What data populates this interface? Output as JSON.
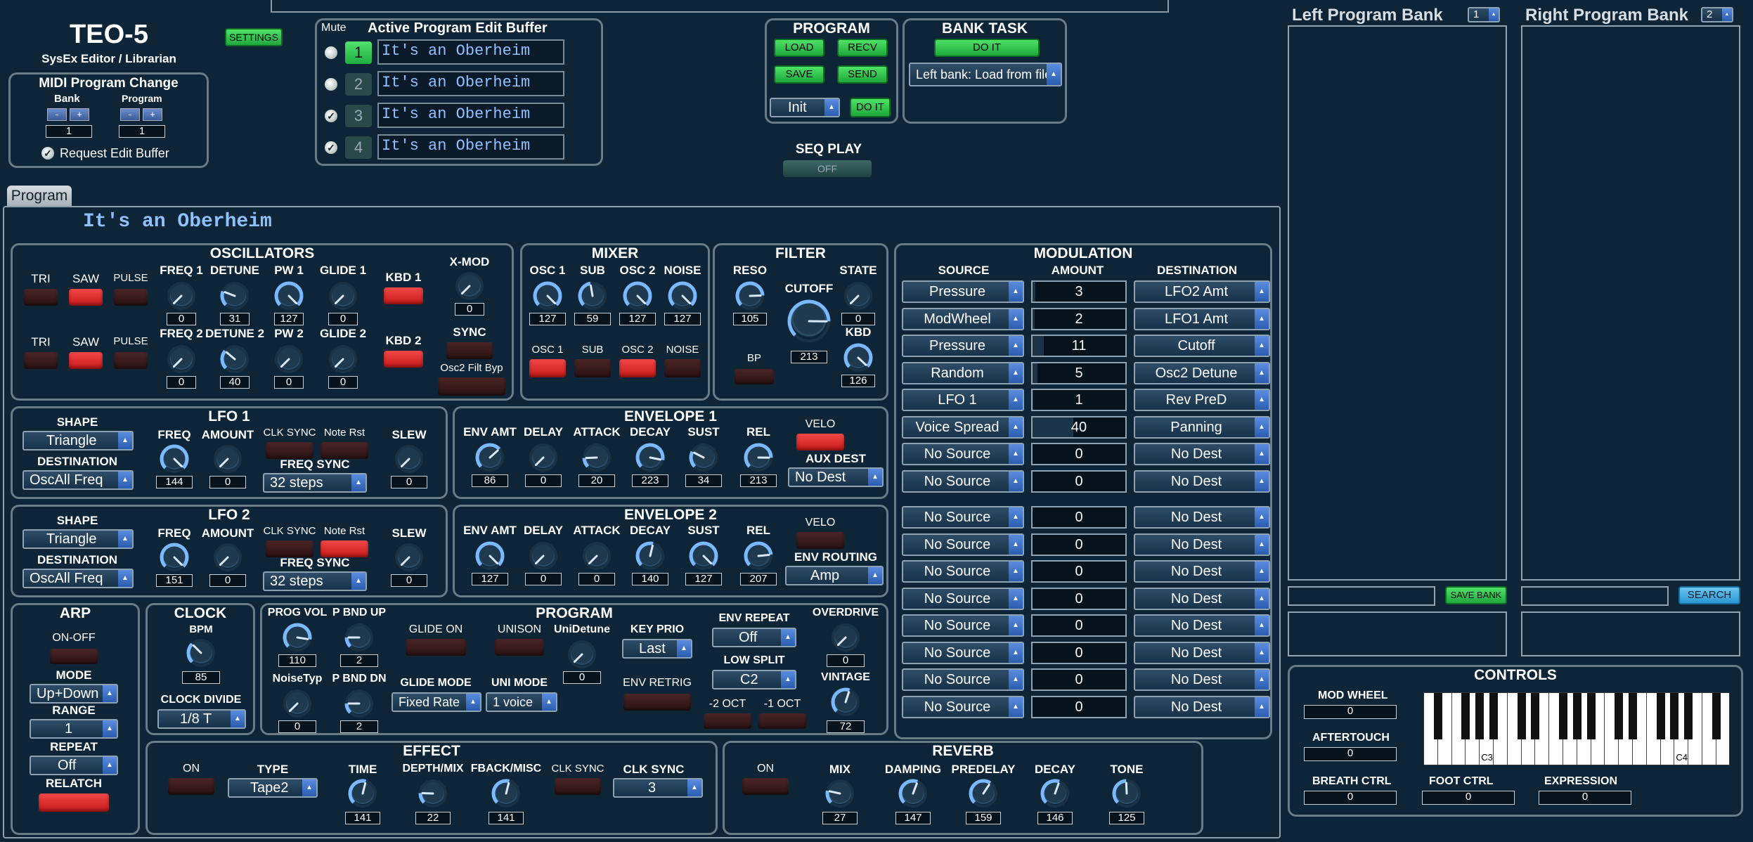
{
  "app": {
    "title": "TEO-5",
    "subtitle": "SysEx Editor / Librarian",
    "settings": "SETTINGS"
  },
  "midi": {
    "title": "MIDI Program Change",
    "bank_label": "Bank",
    "program_label": "Program",
    "bank_value": "1",
    "program_value": "1",
    "minus": "-",
    "plus": "+",
    "request_label": "Request Edit Buffer"
  },
  "edit_buffer": {
    "mute_label": "Mute",
    "title": "Active Program Edit Buffer",
    "slots": [
      {
        "num": "1",
        "name": "It's an Oberheim"
      },
      {
        "num": "2",
        "name": "It's an Oberheim"
      },
      {
        "num": "3",
        "name": "It's an Oberheim"
      },
      {
        "num": "4",
        "name": "It's an Oberheim"
      }
    ]
  },
  "program_box": {
    "title": "PROGRAM",
    "load": "LOAD",
    "recv": "RECV",
    "save": "SAVE",
    "send": "SEND",
    "init": "Init",
    "doit": "DO IT"
  },
  "bank_task": {
    "title": "BANK TASK",
    "doit": "DO IT",
    "select": "Left bank: Load from file"
  },
  "seq": {
    "title": "SEQ PLAY",
    "button": "OFF"
  },
  "tab": "Program",
  "program_name": "It's an Oberheim",
  "osc": {
    "title": "OSCILLATORS",
    "tri": "TRI",
    "saw": "SAW",
    "pulse": "PULSE",
    "freq1": "FREQ 1",
    "detune": "DETUNE",
    "pw1": "PW 1",
    "glide1": "GLIDE 1",
    "kbd1": "KBD 1",
    "xmod": "X-MOD",
    "freq2": "FREQ 2",
    "detune2": "DETUNE 2",
    "pw2": "PW 2",
    "glide2": "GLIDE 2",
    "kbd2": "KBD 2",
    "sync": "SYNC",
    "bypass": "Osc2 Filt Byp",
    "v_freq1": "0",
    "v_detune": "31",
    "v_pw1": "127",
    "v_glide1": "0",
    "v_xmod": "0",
    "v_freq2": "0",
    "v_detune2": "40",
    "v_pw2": "0",
    "v_glide2": "0"
  },
  "mixer": {
    "title": "MIXER",
    "osc1": "OSC 1",
    "sub": "SUB",
    "osc2": "OSC 2",
    "noise": "NOISE",
    "v_osc1": "127",
    "v_sub": "59",
    "v_osc2": "127",
    "v_noise": "127"
  },
  "filter": {
    "title": "FILTER",
    "reso": "RESO",
    "cutoff": "CUTOFF",
    "state": "STATE",
    "kbd": "KBD",
    "bp": "BP",
    "v_reso": "105",
    "v_cutoff": "213",
    "v_state": "0",
    "v_kbd": "126"
  },
  "mod": {
    "title": "MODULATION",
    "source": "SOURCE",
    "amount": "AMOUNT",
    "destination": "DESTINATION",
    "rows": [
      {
        "src": "Pressure",
        "amt": "3",
        "dst": "LFO2 Amt"
      },
      {
        "src": "ModWheel",
        "amt": "2",
        "dst": "LFO1 Amt"
      },
      {
        "src": "Pressure",
        "amt": "11",
        "dst": "Cutoff"
      },
      {
        "src": "Random",
        "amt": "5",
        "dst": "Osc2 Detune"
      },
      {
        "src": "LFO 1",
        "amt": "1",
        "dst": "Rev PreD"
      },
      {
        "src": "Voice Spread",
        "amt": "40",
        "dst": "Panning"
      },
      {
        "src": "No Source",
        "amt": "0",
        "dst": "No Dest"
      },
      {
        "src": "No Source",
        "amt": "0",
        "dst": "No Dest"
      },
      {
        "src": "No Source",
        "amt": "0",
        "dst": "No Dest"
      },
      {
        "src": "No Source",
        "amt": "0",
        "dst": "No Dest"
      },
      {
        "src": "No Source",
        "amt": "0",
        "dst": "No Dest"
      },
      {
        "src": "No Source",
        "amt": "0",
        "dst": "No Dest"
      },
      {
        "src": "No Source",
        "amt": "0",
        "dst": "No Dest"
      },
      {
        "src": "No Source",
        "amt": "0",
        "dst": "No Dest"
      },
      {
        "src": "No Source",
        "amt": "0",
        "dst": "No Dest"
      },
      {
        "src": "No Source",
        "amt": "0",
        "dst": "No Dest"
      }
    ]
  },
  "lfo1": {
    "title": "LFO 1",
    "shape": "SHAPE",
    "shape_val": "Triangle",
    "dest": "DESTINATION",
    "dest_val": "OscAll Freq",
    "freq": "FREQ",
    "amount": "AMOUNT",
    "clk": "CLK SYNC",
    "rst": "Note Rst",
    "slew": "SLEW",
    "fsync": "FREQ SYNC",
    "fsync_val": "32 steps",
    "v_freq": "144",
    "v_amount": "0",
    "v_slew": "0"
  },
  "lfo2": {
    "title": "LFO 2",
    "shape": "SHAPE",
    "shape_val": "Triangle",
    "dest": "DESTINATION",
    "dest_val": "OscAll Freq",
    "freq": "FREQ",
    "amount": "AMOUNT",
    "clk": "CLK SYNC",
    "rst": "Note Rst",
    "slew": "SLEW",
    "fsync": "FREQ SYNC",
    "fsync_val": "32 steps",
    "v_freq": "151",
    "v_amount": "0",
    "v_slew": "0"
  },
  "env1": {
    "title": "ENVELOPE 1",
    "amt": "ENV AMT",
    "delay": "DELAY",
    "attack": "ATTACK",
    "decay": "DECAY",
    "sust": "SUST",
    "rel": "REL",
    "velo": "VELO",
    "aux": "AUX DEST",
    "aux_val": "No Dest",
    "v_amt": "86",
    "v_delay": "0",
    "v_attack": "20",
    "v_decay": "223",
    "v_sust": "34",
    "v_rel": "213"
  },
  "env2": {
    "title": "ENVELOPE 2",
    "amt": "ENV AMT",
    "delay": "DELAY",
    "attack": "ATTACK",
    "decay": "DECAY",
    "sust": "SUST",
    "rel": "REL",
    "velo": "VELO",
    "routing": "ENV ROUTING",
    "routing_val": "Amp",
    "v_amt": "127",
    "v_delay": "0",
    "v_attack": "0",
    "v_decay": "140",
    "v_sust": "127",
    "v_rel": "207"
  },
  "arp": {
    "title": "ARP",
    "onoff": "ON-OFF",
    "mode": "MODE",
    "mode_val": "Up+Down",
    "range": "RANGE",
    "range_val": "1",
    "repeat": "REPEAT",
    "repeat_val": "Off",
    "relatch": "RELATCH"
  },
  "clock": {
    "title": "CLOCK",
    "bpm": "BPM",
    "v_bpm": "85",
    "divide": "CLOCK DIVIDE",
    "divide_val": "1/8 T"
  },
  "prog": {
    "title": "PROGRAM",
    "vol": "PROG VOL",
    "pbup": "P BND UP",
    "glide_on": "GLIDE ON",
    "unison": "UNISON",
    "unidetune": "UniDetune",
    "keyprio": "KEY PRIO",
    "keyprio_val": "Last",
    "envrep": "ENV REPEAT",
    "envrep_val": "Off",
    "overdrive": "OVERDRIVE",
    "noisetyp": "NoiseTyp",
    "pbdn": "P BND DN",
    "glidemode": "GLIDE MODE",
    "glidemode_val": "Fixed Rate",
    "unimode": "UNI MODE",
    "unimode_val": "1 voice",
    "envretrig": "ENV RETRIG",
    "lowsplit": "LOW SPLIT",
    "lowsplit_val": "C2",
    "oct2": "-2 OCT",
    "oct1": "-1 OCT",
    "vintage": "VINTAGE",
    "v_vol": "110",
    "v_pbup": "2",
    "v_unidetune": "0",
    "v_overdrive": "0",
    "v_noisetyp": "0",
    "v_pbdn": "2",
    "v_vintage": "72"
  },
  "effect": {
    "title": "EFFECT",
    "on": "ON",
    "type": "TYPE",
    "type_val": "Tape2",
    "time": "TIME",
    "depth": "DEPTH/MIX",
    "fback": "FBACK/MISC",
    "clk": "CLK SYNC",
    "clksync": "CLK SYNC",
    "clksync_val": "3",
    "v_time": "141",
    "v_depth": "22",
    "v_fback": "141"
  },
  "reverb": {
    "title": "REVERB",
    "on": "ON",
    "mix": "MIX",
    "damping": "DAMPING",
    "predelay": "PREDELAY",
    "decay": "DECAY",
    "tone": "TONE",
    "v_mix": "27",
    "v_damping": "147",
    "v_predelay": "159",
    "v_decay": "146",
    "v_tone": "125"
  },
  "banks": {
    "left": "Left Program Bank",
    "left_num": "1",
    "right": "Right Program Bank",
    "right_num": "2",
    "save": "SAVE BANK",
    "search": "SEARCH"
  },
  "controls": {
    "title": "CONTROLS",
    "modwheel": "MOD WHEEL",
    "v_modwheel": "0",
    "aftertouch": "AFTERTOUCH",
    "v_aftertouch": "0",
    "breath": "BREATH CTRL",
    "v_breath": "0",
    "foot": "FOOT CTRL",
    "v_foot": "0",
    "expression": "EXPRESSION",
    "v_expression": "0",
    "c3": "C3",
    "c4": "C4"
  },
  "colors": {
    "bg": "#0d2537",
    "red": "#e53232",
    "green": "#34d24f",
    "text_blue": "#8fc0ff"
  }
}
